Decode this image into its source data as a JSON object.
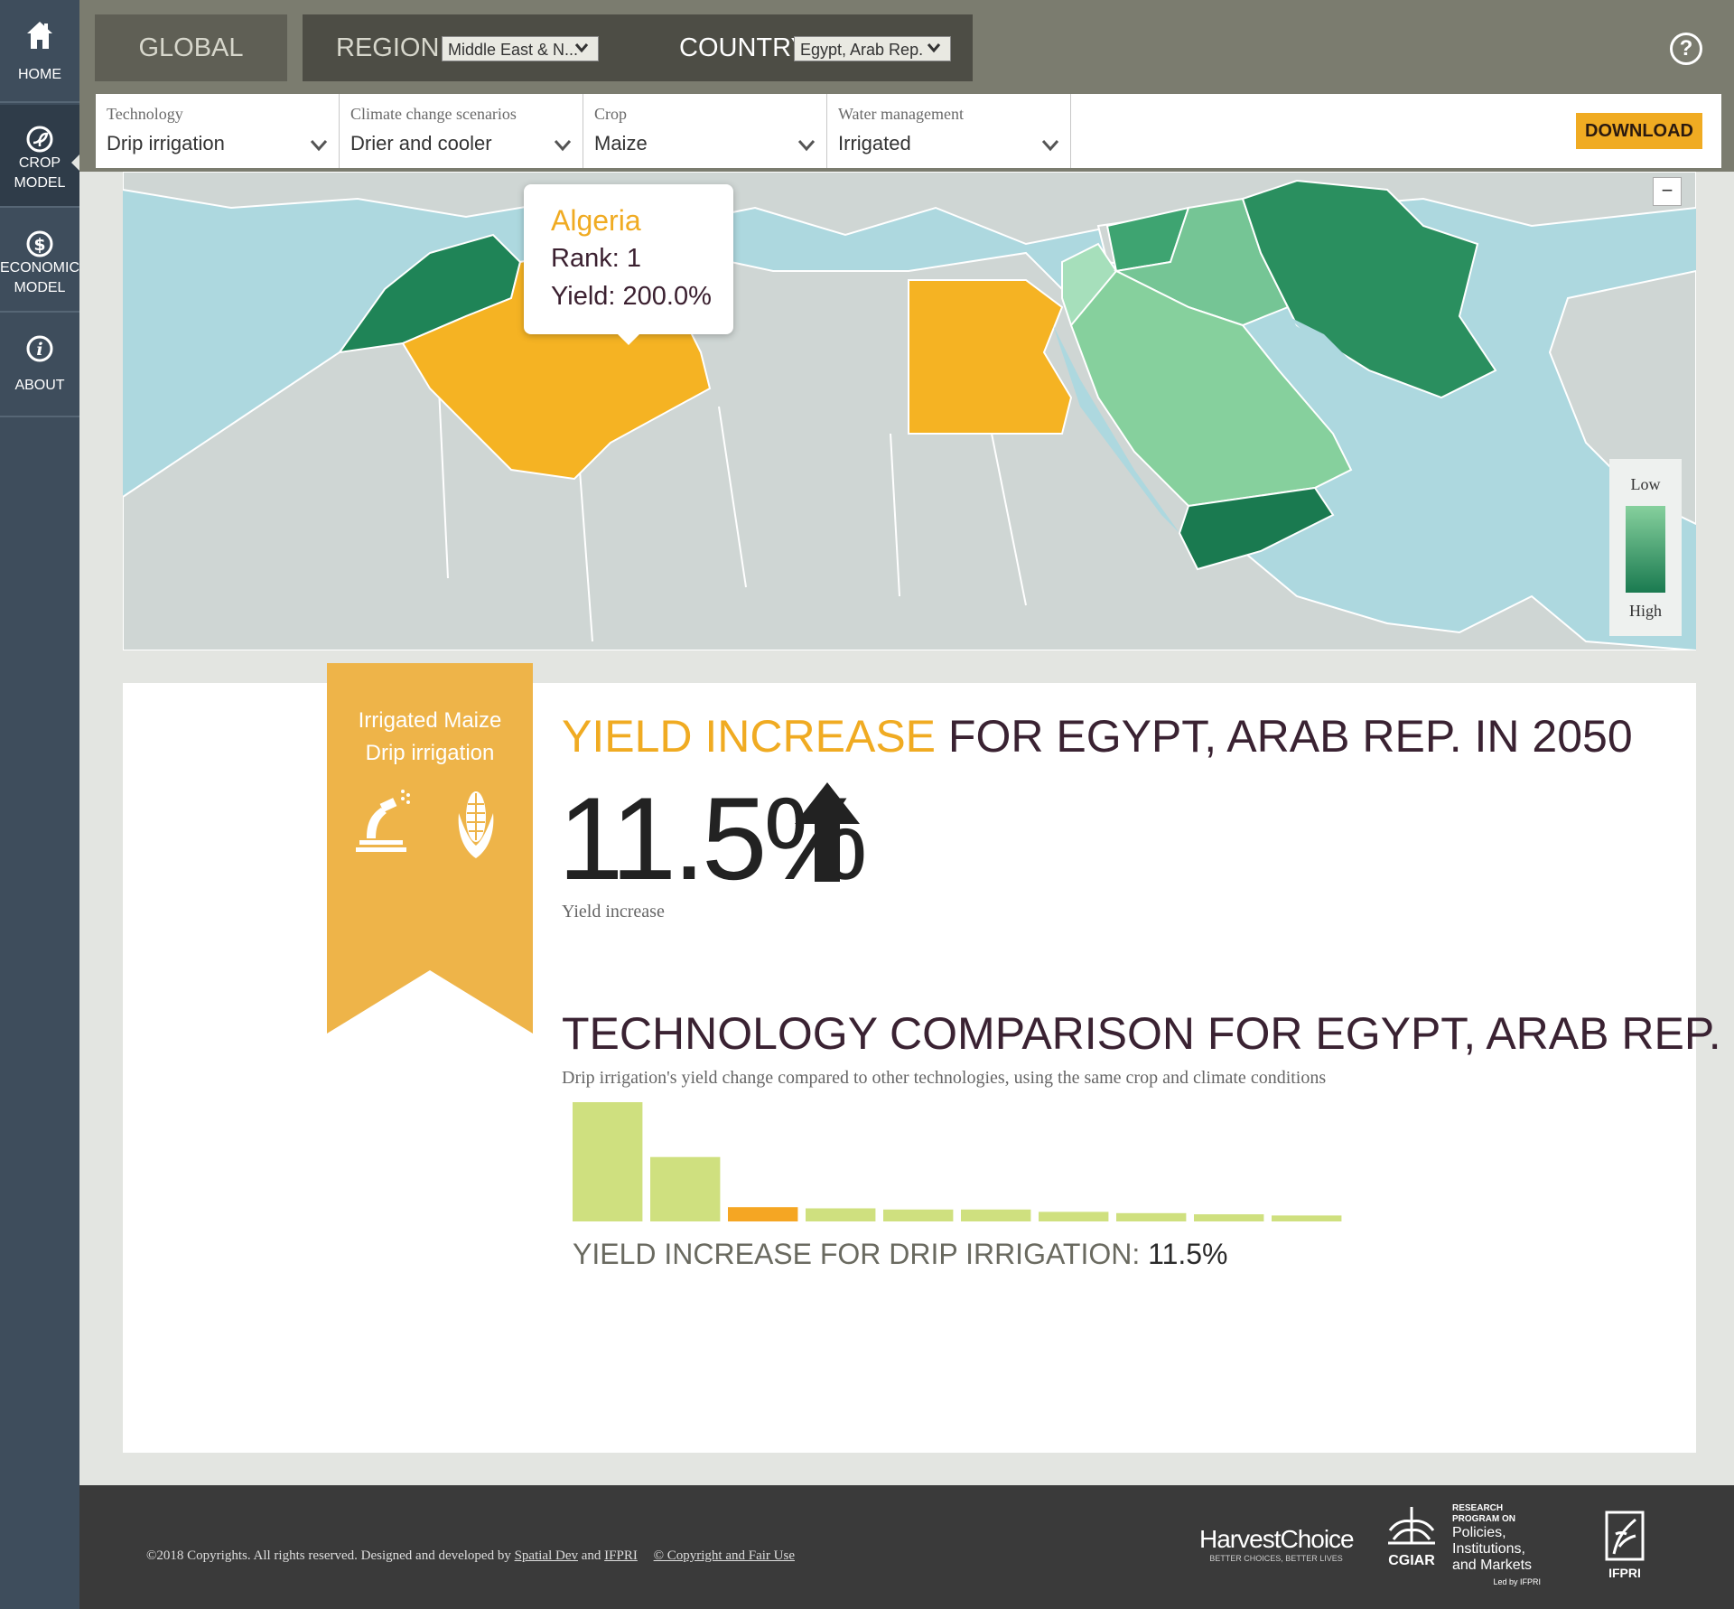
{
  "sidebar": {
    "items": [
      {
        "label_1": "HOME",
        "label_2": "",
        "icon": "home-icon"
      },
      {
        "label_1": "CROP",
        "label_2": "MODEL",
        "icon": "crop-model-icon"
      },
      {
        "label_1": "ECONOMIC",
        "label_2": "MODEL",
        "icon": "dollar-icon"
      },
      {
        "label_1": "ABOUT",
        "label_2": "",
        "icon": "info-icon"
      }
    ],
    "active_index": 1
  },
  "levels": {
    "global": "GLOBAL",
    "region": "REGION",
    "region_value": "Middle East & N...",
    "country": "COUNTRY",
    "country_value": "Egypt, Arab Rep."
  },
  "filters": [
    {
      "label": "Technology",
      "value": "Drip irrigation"
    },
    {
      "label": "Climate change scenarios",
      "value": "Drier and cooler"
    },
    {
      "label": "Crop",
      "value": "Maize"
    },
    {
      "label": "Water management",
      "value": "Irrigated"
    }
  ],
  "download_label": "DOWNLOAD",
  "help_label": "?",
  "map": {
    "zoom_out": "−",
    "tooltip": {
      "country": "Algeria",
      "rank": "Rank: 1",
      "yield": "Yield: 200.0%"
    },
    "legend": {
      "low": "Low",
      "high": "High"
    },
    "colors": {
      "water": "#add8df",
      "land": "#cfd6d4",
      "highlight": "#f5b323",
      "low": "#86d09d",
      "high": "#1a7a50"
    }
  },
  "ribbon": {
    "line1": "Irrigated Maize",
    "line2": "Drip irrigation",
    "icons": [
      "drip-irrigation-icon",
      "maize-icon"
    ]
  },
  "yield": {
    "title_highlight": "YIELD INCREASE",
    "title_rest": " FOR EGYPT, ARAB REP. IN 2050",
    "value": "11.5%",
    "caption": "Yield increase"
  },
  "comparison": {
    "title": "TECHNOLOGY COMPARISON FOR EGYPT, ARAB REP.",
    "subtitle": "Drip irrigation's yield change compared to other technologies, using the same crop and climate conditions",
    "caption_label": "YIELD INCREASE FOR DRIP IRRIGATION: ",
    "caption_value": "11.5%"
  },
  "chart_data": {
    "type": "bar",
    "categories": [
      "",
      "",
      "",
      "",
      "",
      "",
      "",
      "",
      "",
      ""
    ],
    "values": [
      100,
      54,
      12,
      11,
      10,
      10,
      8,
      7,
      6,
      5
    ],
    "highlight_index": 2,
    "colors": {
      "default": "#cfe07f",
      "highlight": "#f5a623"
    },
    "ylim": [
      0,
      100
    ]
  },
  "footer": {
    "copyright": "©2018 Copyrights. All rights reserved. Designed and developed by ",
    "link1": "Spatial Dev",
    "and": " and ",
    "link2": "IFPRI",
    "link3": "© Copyright and Fair Use",
    "logos": {
      "harvestchoice": "HarvestChoice",
      "harvestchoice_tag": "BETTER CHOICES, BETTER LIVES",
      "cgiar": "CGIAR",
      "pim_1": "RESEARCH",
      "pim_2": "PROGRAM ON",
      "pim_3": "Policies,",
      "pim_4": "Institutions,",
      "pim_5": "and Markets",
      "pim_6": "Led by IFPRI",
      "ifpri": "IFPRI"
    }
  }
}
